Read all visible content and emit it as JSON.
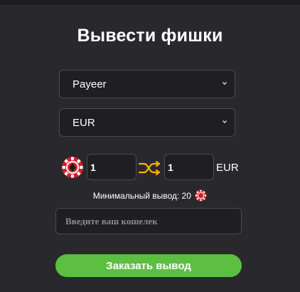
{
  "title": "Вывести фишки",
  "payment_method": {
    "selected": "Payeer"
  },
  "currency_select": {
    "selected": "EUR"
  },
  "exchange": {
    "chips_amount": "1",
    "currency_amount": "1",
    "currency_label": "EUR"
  },
  "minimum": {
    "label": "Минимальный вывод: 20"
  },
  "wallet": {
    "placeholder": "Введите ваш кошелек",
    "value": ""
  },
  "submit_label": "Заказать вывод",
  "colors": {
    "accent": "#5cbf41",
    "chip_red": "#d21f2b",
    "swap_icon": "#f5b400"
  }
}
